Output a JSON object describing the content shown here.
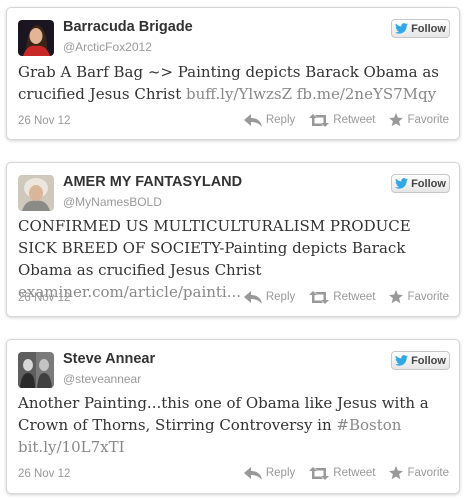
{
  "colors": {
    "twitter_blue": "#2fa8e5",
    "link": "#888888",
    "text": "#333333",
    "meta": "#999999"
  },
  "icons": {
    "follow": "twitter-bird-icon",
    "reply": "reply-icon",
    "retweet": "retweet-icon",
    "favorite": "star-icon"
  },
  "tweets": [
    {
      "name": "Barracuda Brigade",
      "handle": "@ArcticFox2012",
      "follow_label": "Follow",
      "text_plain": "Grab A Barf Bag ~> Painting depicts Barack Obama as crucified Jesus Christ ",
      "links": "buff.ly/YlwzsZ fb.me/2neYS7Mqy",
      "date": "26 Nov 12",
      "reply_label": "Reply",
      "retweet_label": "Retweet",
      "favorite_label": "Favorite"
    },
    {
      "name": "AMER MY FANTASYLAND",
      "handle": "@MyNamesBOLD",
      "follow_label": "Follow",
      "text_plain": "CONFIRMED US MULTICULTURALISM PRODUCE SICK BREED OF SOCIETY-Painting depicts Barack Obama as crucified Jesus Christ ",
      "links": "examiner.com/article/painti...",
      "date": "26 Nov 12",
      "reply_label": "Reply",
      "retweet_label": "Retweet",
      "favorite_label": "Favorite"
    },
    {
      "name": "Steve Annear",
      "handle": "@steveannear",
      "follow_label": "Follow",
      "text_plain": "Another Painting...this one of Obama like Jesus with a Crown of Thorns, Stirring Controversy in ",
      "hashtag": "#Boston",
      "links": "bit.ly/10L7xTI",
      "date": "26 Nov 12",
      "reply_label": "Reply",
      "retweet_label": "Retweet",
      "favorite_label": "Favorite"
    }
  ]
}
